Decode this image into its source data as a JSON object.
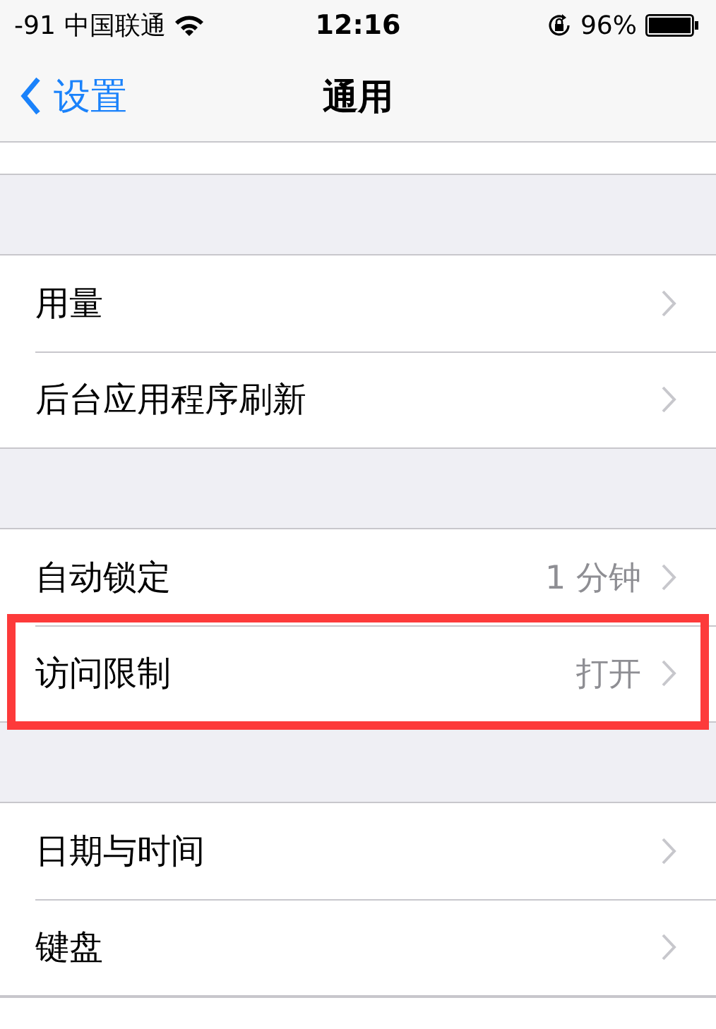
{
  "status_bar": {
    "signal": "-91",
    "carrier": "中国联通",
    "time": "12:16",
    "battery": "96%"
  },
  "nav": {
    "back": "设置",
    "title": "通用"
  },
  "groups": [
    {
      "items": [
        {
          "label": "用量",
          "highlighted": false
        },
        {
          "label": "后台应用程序刷新",
          "highlighted": false
        }
      ]
    },
    {
      "items": [
        {
          "label": "自动锁定",
          "value": "1 分钟",
          "highlighted": false
        },
        {
          "label": "访问限制",
          "value": "打开",
          "highlighted": true
        }
      ]
    },
    {
      "items": [
        {
          "label": "日期与时间",
          "highlighted": false
        },
        {
          "label": "键盘",
          "highlighted": false
        }
      ]
    }
  ]
}
